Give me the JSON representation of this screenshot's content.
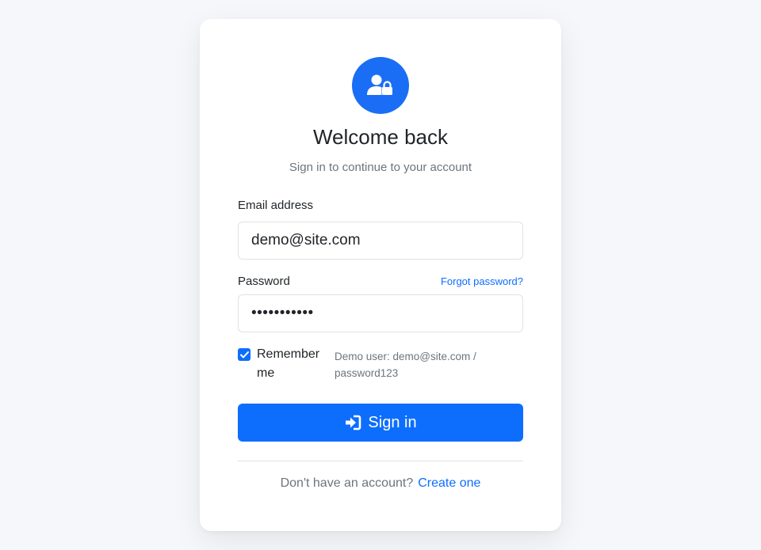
{
  "header": {
    "icon": "user-lock-icon",
    "title": "Welcome back",
    "subtitle": "Sign in to continue to your account"
  },
  "form": {
    "email": {
      "label": "Email address",
      "value": "demo@site.com"
    },
    "password": {
      "label": "Password",
      "value": "•••••••••••",
      "forgot_link": "Forgot password?"
    },
    "remember": {
      "label": "Remember me",
      "checked": true
    },
    "hint": "Demo user: demo@site.com / password123",
    "submit_label": "Sign in",
    "submit_icon": "sign-in-icon"
  },
  "footer": {
    "prompt": "Don't have an account?",
    "link": "Create one"
  },
  "colors": {
    "primary": "#0d6efd",
    "avatar": "#1a6ef5",
    "background": "#f5f7fa",
    "muted_text": "#6c757d"
  }
}
